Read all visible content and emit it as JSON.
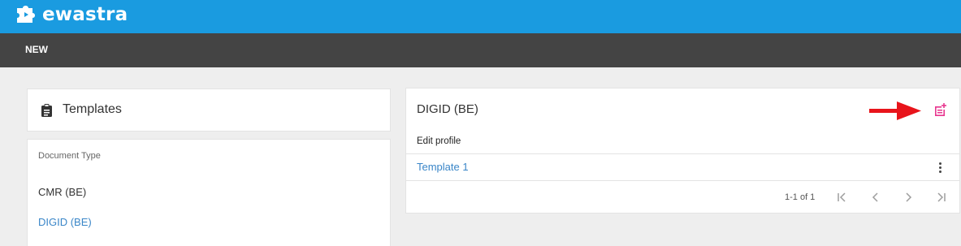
{
  "app": {
    "brand": "ewastra",
    "logo_icon": "puzzle-icon",
    "colors": {
      "header": "#1a9be0",
      "menubar": "#444444",
      "link": "#3a86c8",
      "accent_pink": "#e8368f",
      "arrow_red": "#e8141b"
    }
  },
  "menubar": {
    "new_label": "NEW"
  },
  "templates_panel": {
    "title": "Templates",
    "icon": "clipboard-icon"
  },
  "document_types": {
    "label": "Document Type",
    "items": [
      {
        "label": "CMR (BE)"
      },
      {
        "label": "DIGID (BE)"
      }
    ],
    "selected_index": 1
  },
  "detail": {
    "title": "DIGID (BE)",
    "add_icon": "add-document-icon",
    "edit_profile_label": "Edit profile",
    "rows": [
      {
        "label": "Template 1"
      }
    ],
    "pagination": {
      "range_text": "1-1 of 1"
    }
  }
}
